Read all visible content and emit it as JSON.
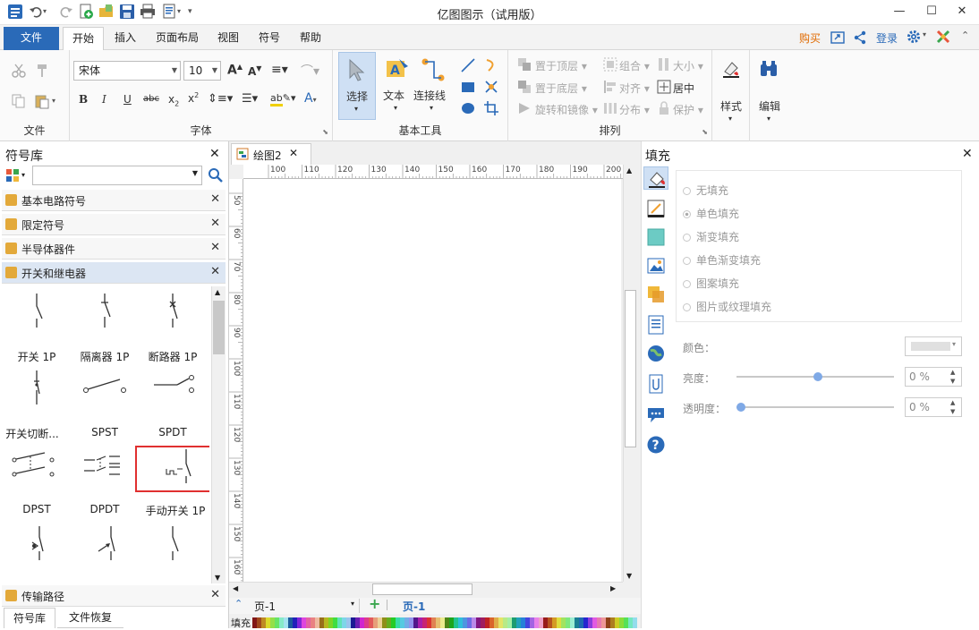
{
  "window": {
    "title": "亿图图示（试用版）"
  },
  "tabs": {
    "file": "文件",
    "home": "开始",
    "insert": "插入",
    "layout": "页面布局",
    "view": "视图",
    "symbol": "符号",
    "help": "帮助"
  },
  "topright": {
    "buy": "购买",
    "login": "登录"
  },
  "ribbon": {
    "file_group": "文件",
    "font_group": "字体",
    "font_name": "宋体",
    "font_size": "10",
    "basic_tools_group": "基本工具",
    "select_label": "选择",
    "text_label": "文本",
    "connector_label": "连接线",
    "arrange_group": "排列",
    "bring_top": "置于顶层",
    "send_bottom": "置于底层",
    "rotate_mirror": "旋转和镜像",
    "group": "组合",
    "align": "对齐",
    "distribute": "分布",
    "size": "大小",
    "center": "居中",
    "protect": "保护",
    "style_label": "样式",
    "edit_label": "编辑"
  },
  "library": {
    "title": "符号库",
    "search_placeholder": "",
    "sections": [
      "基本电路符号",
      "限定符号",
      "半导体器件",
      "开关和继电器"
    ],
    "bottom_section": "传输路径",
    "symbols": [
      "开关 1P",
      "隔离器 1P",
      "断路器 1P",
      "开关切断...",
      "SPST",
      "SPDT",
      "DPST",
      "DPDT",
      "手动开关 1P"
    ],
    "bottom_tabs": [
      "符号库",
      "文件恢复"
    ]
  },
  "document": {
    "tab_name": "绘图2",
    "ruler_top": [
      "100",
      "110",
      "120",
      "130",
      "140",
      "150",
      "160",
      "170",
      "180",
      "190",
      "200"
    ],
    "ruler_left": [
      "50",
      "60",
      "70",
      "80",
      "90",
      "100",
      "110",
      "120",
      "130",
      "140",
      "150",
      "160"
    ],
    "page_selector": "页-1",
    "page_tab": "页-1",
    "fill_label": "填充"
  },
  "fill_panel": {
    "title": "填充",
    "options": [
      "无填充",
      "单色填充",
      "渐变填充",
      "单色渐变填充",
      "图案填充",
      "图片或纹理填充"
    ],
    "color_label": "颜色：",
    "brightness_label": "亮度：",
    "brightness_value": "0 %",
    "transparency_label": "透明度：",
    "transparency_value": "0 %"
  },
  "colors": {
    "accent": "#2a6ab8",
    "buy": "#e06a00",
    "highlight_box": "#e03030"
  }
}
